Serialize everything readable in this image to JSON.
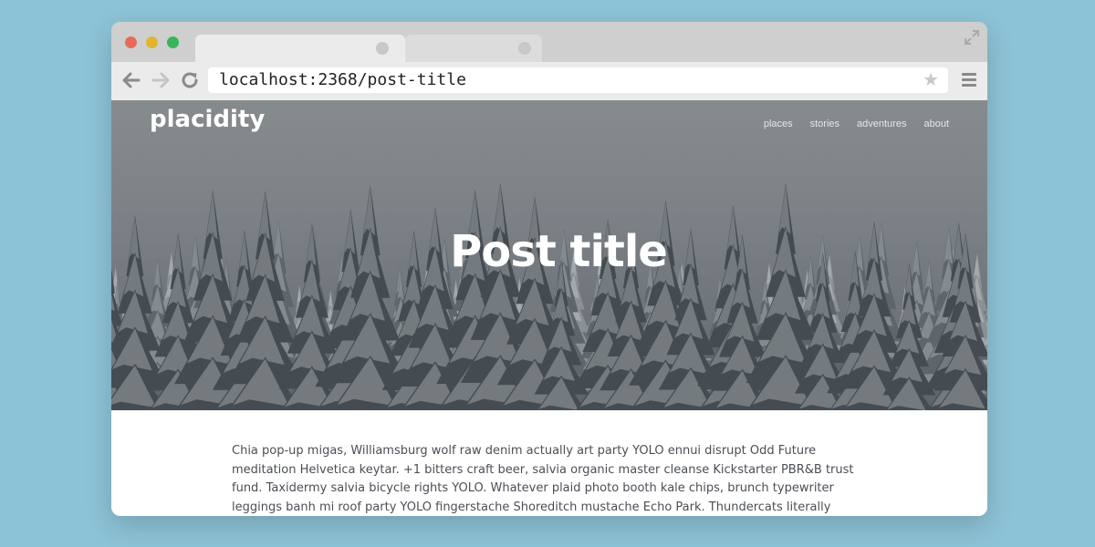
{
  "browser": {
    "url": "localhost:2368/post-title",
    "icons": {
      "back": "back-arrow-icon",
      "forward": "forward-arrow-icon",
      "reload": "reload-icon",
      "star": "star-icon",
      "menu": "hamburger-menu-icon",
      "expand": "expand-icon"
    }
  },
  "site": {
    "title": "placidity",
    "nav": [
      "places",
      "stories",
      "adventures",
      "about"
    ]
  },
  "post": {
    "title": "Post title",
    "body": "Chia pop-up migas, Williamsburg wolf raw denim actually art party YOLO ennui disrupt Odd Future meditation Helvetica keytar. +1 bitters craft beer, salvia organic master cleanse Kickstarter PBR&B trust fund. Taxidermy salvia bicycle rights YOLO. Whatever plaid photo booth kale chips, brunch typewriter leggings banh mi roof party YOLO fingerstache Shoreditch mustache Echo Park. Thundercats literally McSweeney's lumbersexual direct trade. Plaid"
  },
  "colors": {
    "background": "#8dc3d6",
    "hero_overlay": "#7c8286",
    "body_text": "#4a4f55"
  }
}
